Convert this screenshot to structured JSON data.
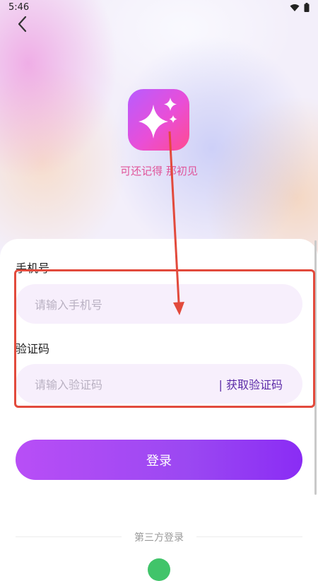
{
  "status_bar": {
    "time": "5:46"
  },
  "header": {
    "slogan": "可还记得 那初见"
  },
  "form": {
    "phone_label": "手机号",
    "phone_placeholder": "请输入手机号",
    "code_label": "验证码",
    "code_placeholder": "请输入验证码",
    "get_code": "| 获取验证码",
    "login_button": "登录"
  },
  "third_party": {
    "title": "第三方登录"
  },
  "colors": {
    "accent_purple": "#9b48f2",
    "slogan_pink": "#e0549a",
    "annotation_red": "#e24a3c",
    "wechat_green": "#41c46a"
  },
  "icons": [
    "back-icon",
    "wifi-icon",
    "battery-icon",
    "sparkle-logo-icon",
    "wechat-icon"
  ]
}
